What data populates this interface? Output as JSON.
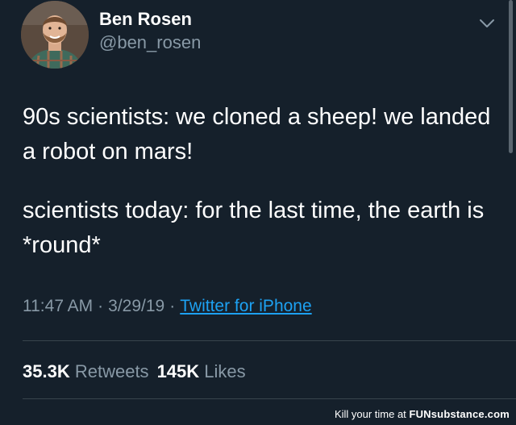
{
  "tweet": {
    "author": {
      "name": "Ben Rosen",
      "handle": "@ben_rosen"
    },
    "text": [
      "90s scientists: we cloned a sheep! we landed a robot on mars!",
      "scientists today: for the last time, the earth is *round*"
    ],
    "time": "11:47 AM",
    "date": "3/29/19",
    "separator": "·",
    "source": "Twitter for iPhone",
    "stats": {
      "retweets_count": "35.3K",
      "retweets_label": "Retweets",
      "likes_count": "145K",
      "likes_label": "Likes"
    }
  },
  "icons": {
    "menu": "chevron-down-icon"
  },
  "watermark": {
    "text": "Kill your time at",
    "brand": "FUNsubstance.com"
  },
  "colors": {
    "background": "#15202b",
    "primary_text": "#ffffff",
    "secondary_text": "#8899a6",
    "link": "#1da1f2",
    "divider": "#38444d"
  }
}
